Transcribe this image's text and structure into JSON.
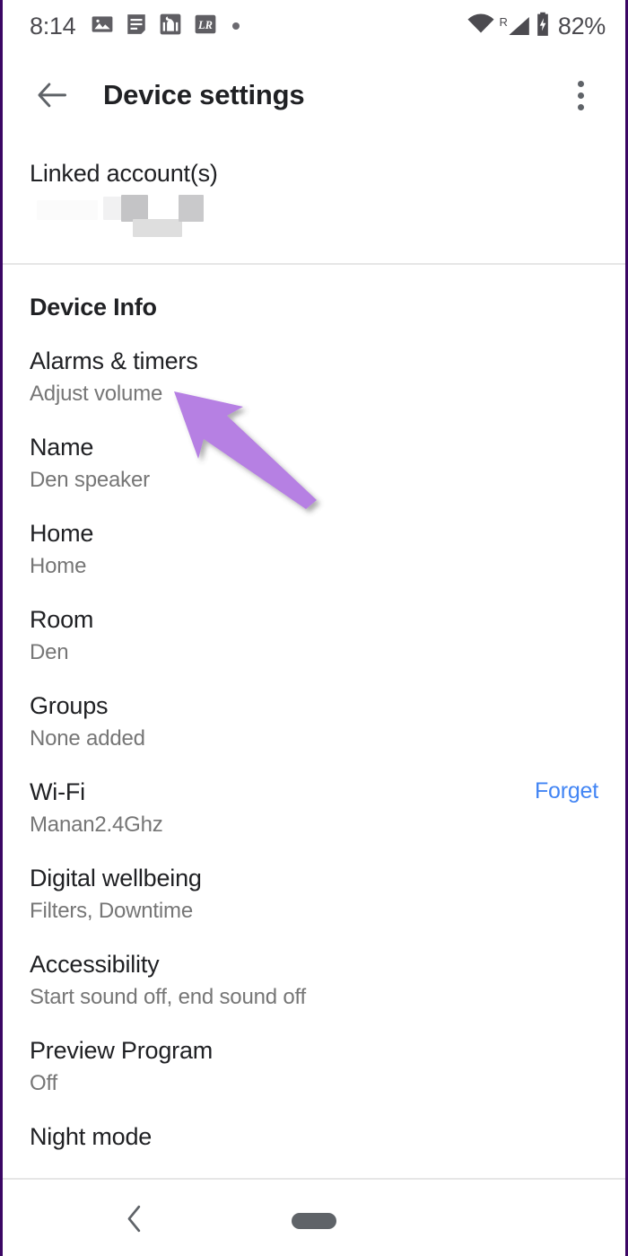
{
  "status_bar": {
    "clock": "8:14",
    "battery_percent": "82%",
    "roaming_label": "R",
    "icons": [
      "photos-icon",
      "notes-icon",
      "mosque-icon",
      "lightroom-icon",
      "notification-dot-icon",
      "wifi-icon",
      "cellular-signal-icon",
      "battery-charging-icon"
    ]
  },
  "app_bar": {
    "title": "Device settings",
    "back_icon": "back-arrow-icon",
    "overflow_icon": "overflow-menu-icon"
  },
  "linked_accounts": {
    "title": "Linked account(s)",
    "value_redacted": true
  },
  "device_info": {
    "section_title": "Device Info",
    "rows": [
      {
        "title": "Alarms & timers",
        "subtitle": "Adjust volume",
        "action": null
      },
      {
        "title": "Name",
        "subtitle": "Den speaker",
        "action": null
      },
      {
        "title": "Home",
        "subtitle": "Home",
        "action": null
      },
      {
        "title": "Room",
        "subtitle": "Den",
        "action": null
      },
      {
        "title": "Groups",
        "subtitle": "None added",
        "action": null
      },
      {
        "title": "Wi-Fi",
        "subtitle": "Manan2.4Ghz",
        "action": "Forget"
      },
      {
        "title": "Digital wellbeing",
        "subtitle": "Filters, Downtime",
        "action": null
      },
      {
        "title": "Accessibility",
        "subtitle": "Start sound off, end sound off",
        "action": null
      },
      {
        "title": "Preview Program",
        "subtitle": "Off",
        "action": null
      },
      {
        "title": "Night mode",
        "subtitle": "",
        "action": null
      }
    ]
  },
  "annotation": {
    "type": "arrow",
    "points_to": "Alarms & timers",
    "color": "#b680e3"
  },
  "nav_bar": {
    "back_icon": "nav-back-chevron-icon",
    "home_icon": "nav-home-pill-icon"
  },
  "colors": {
    "accent_link": "#4285f4",
    "title_text": "#202124",
    "subtitle_text": "#767676",
    "annotation": "#b680e3",
    "frame_border": "#3b0764"
  }
}
